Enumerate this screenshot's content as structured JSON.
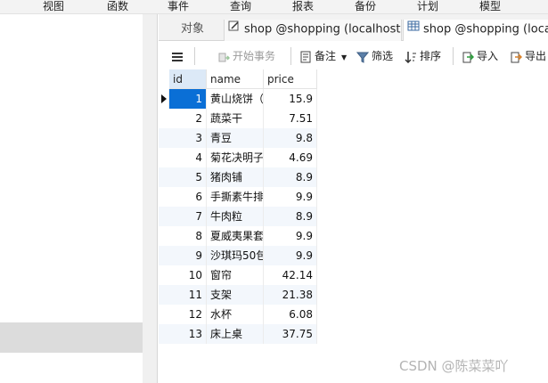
{
  "menu": [
    "视图",
    "函数",
    "事件",
    "查询",
    "报表",
    "备份",
    "计划",
    "模型"
  ],
  "tabs": {
    "objects": "对象",
    "tab1": "shop @shopping (localhost...",
    "tab2": "shop @shopping (localh"
  },
  "toolbar": {
    "begin_tx": "开始事务",
    "note": "备注",
    "filter": "筛选",
    "sort": "排序",
    "import": "导入",
    "export": "导出"
  },
  "table": {
    "columns": [
      "id",
      "name",
      "price"
    ],
    "rows": [
      {
        "id": "1",
        "name": "黄山烧饼（",
        "price": "15.9"
      },
      {
        "id": "2",
        "name": "蔬菜干",
        "price": "7.51"
      },
      {
        "id": "3",
        "name": "青豆",
        "price": "9.8"
      },
      {
        "id": "4",
        "name": "菊花决明子",
        "price": "4.69"
      },
      {
        "id": "5",
        "name": "猪肉铺",
        "price": "8.9"
      },
      {
        "id": "6",
        "name": "手撕素牛排",
        "price": "9.9"
      },
      {
        "id": "7",
        "name": "牛肉粒",
        "price": "8.9"
      },
      {
        "id": "8",
        "name": "夏威夷果套",
        "price": "9.9"
      },
      {
        "id": "9",
        "name": "沙琪玛50包",
        "price": "9.9"
      },
      {
        "id": "10",
        "name": "窗帘",
        "price": "42.14"
      },
      {
        "id": "11",
        "name": "支架",
        "price": "21.38"
      },
      {
        "id": "12",
        "name": "水杯",
        "price": "6.08"
      },
      {
        "id": "13",
        "name": "床上桌",
        "price": "37.75"
      }
    ]
  },
  "watermark": "CSDN @陈菜菜吖",
  "colors": {
    "selected": "#0a6fd6",
    "header_id": "#dce9f7",
    "row_alt": "#f3f7fc"
  }
}
